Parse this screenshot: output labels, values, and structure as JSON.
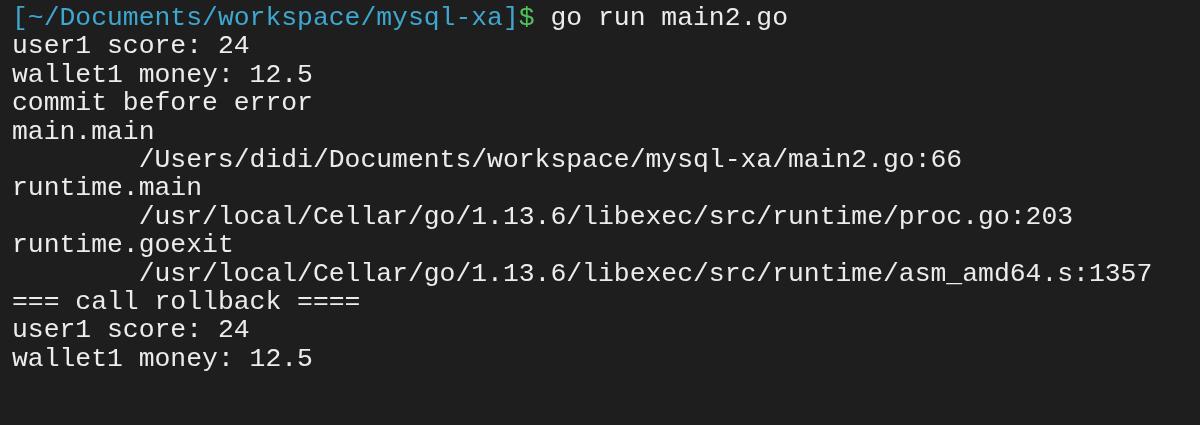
{
  "prompt": {
    "path": "[~/Documents/workspace/mysql-xa]",
    "symbol": "$",
    "command": "go run main2.go"
  },
  "lines": [
    {
      "kind": "output",
      "text": "user1 score: 24"
    },
    {
      "kind": "output",
      "text": "wallet1 money: 12.5"
    },
    {
      "kind": "output",
      "text": "commit before error"
    },
    {
      "kind": "output",
      "text": "main.main"
    },
    {
      "kind": "location",
      "text": "/Users/didi/Documents/workspace/mysql-xa/main2.go:66"
    },
    {
      "kind": "output",
      "text": "runtime.main"
    },
    {
      "kind": "location",
      "text": "/usr/local/Cellar/go/1.13.6/libexec/src/runtime/proc.go:203"
    },
    {
      "kind": "output",
      "text": "runtime.goexit"
    },
    {
      "kind": "location",
      "text": "/usr/local/Cellar/go/1.13.6/libexec/src/runtime/asm_amd64.s:1357"
    },
    {
      "kind": "output",
      "text": "=== call rollback ===="
    },
    {
      "kind": "output",
      "text": "user1 score: 24"
    },
    {
      "kind": "output",
      "text": "wallet1 money: 12.5"
    }
  ]
}
